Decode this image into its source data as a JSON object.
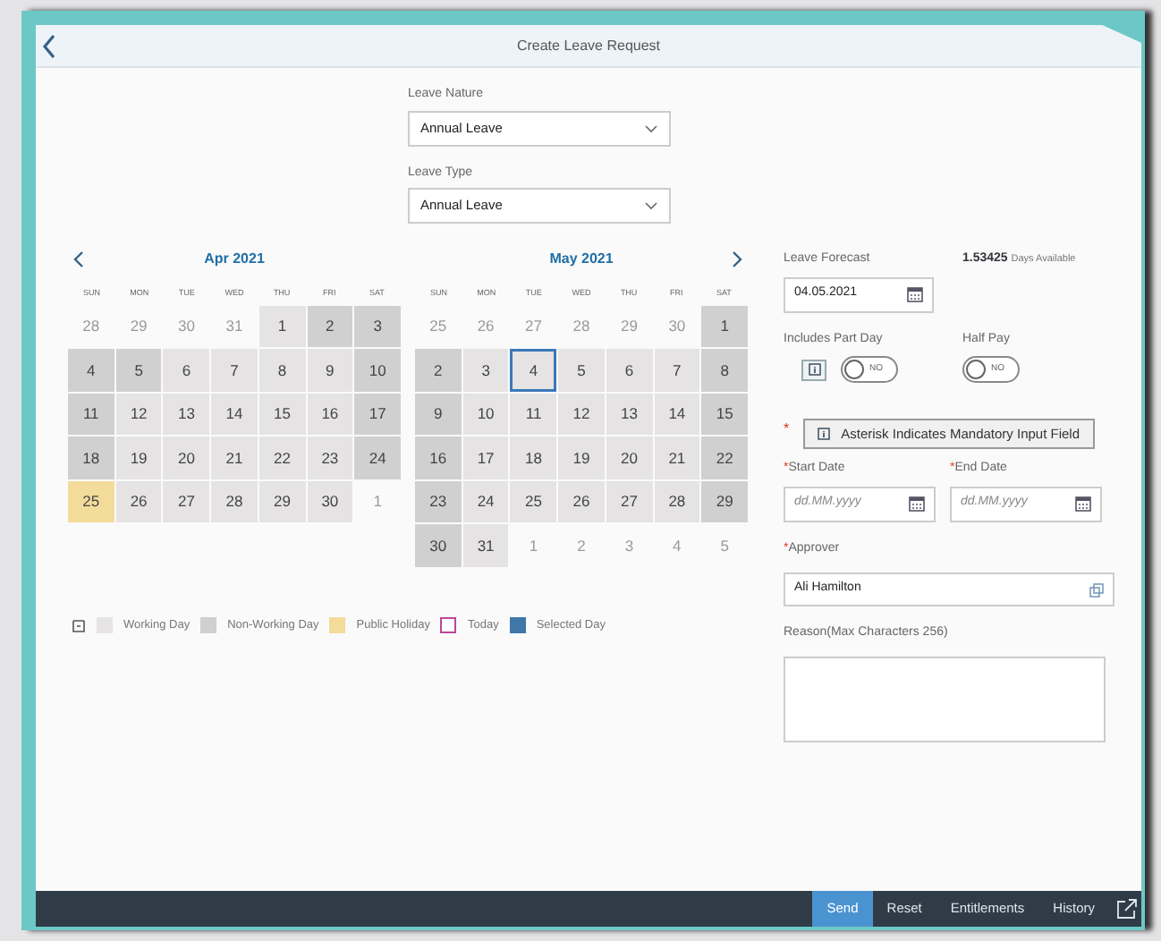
{
  "header": {
    "title": "Create Leave Request"
  },
  "selects": [
    {
      "label": "Leave Nature",
      "value": "Annual Leave"
    },
    {
      "label": "Leave Type",
      "value": "Annual Leave"
    }
  ],
  "calendars": [
    {
      "month": "Apr 2021",
      "prev_button": true,
      "next_button": false,
      "weekdays": [
        "SUN",
        "MON",
        "TUE",
        "WED",
        "THU",
        "FRI",
        "SAT"
      ],
      "weeks": [
        [
          {
            "day": "28",
            "kind": "other",
            "focused": false
          },
          {
            "day": "29",
            "kind": "other",
            "focused": false
          },
          {
            "day": "30",
            "kind": "other",
            "focused": false
          },
          {
            "day": "31",
            "kind": "other",
            "focused": false
          },
          {
            "day": "1",
            "kind": "working",
            "focused": false
          },
          {
            "day": "2",
            "kind": "nonworking",
            "focused": false
          },
          {
            "day": "3",
            "kind": "nonworking",
            "focused": false
          }
        ],
        [
          {
            "day": "4",
            "kind": "nonworking",
            "focused": false
          },
          {
            "day": "5",
            "kind": "nonworking",
            "focused": false
          },
          {
            "day": "6",
            "kind": "working",
            "focused": false
          },
          {
            "day": "7",
            "kind": "working",
            "focused": false
          },
          {
            "day": "8",
            "kind": "working",
            "focused": false
          },
          {
            "day": "9",
            "kind": "working",
            "focused": false
          },
          {
            "day": "10",
            "kind": "nonworking",
            "focused": false
          }
        ],
        [
          {
            "day": "11",
            "kind": "nonworking",
            "focused": false
          },
          {
            "day": "12",
            "kind": "working",
            "focused": false
          },
          {
            "day": "13",
            "kind": "working",
            "focused": false
          },
          {
            "day": "14",
            "kind": "working",
            "focused": false
          },
          {
            "day": "15",
            "kind": "working",
            "focused": false
          },
          {
            "day": "16",
            "kind": "working",
            "focused": false
          },
          {
            "day": "17",
            "kind": "nonworking",
            "focused": false
          }
        ],
        [
          {
            "day": "18",
            "kind": "nonworking",
            "focused": false
          },
          {
            "day": "19",
            "kind": "working",
            "focused": false
          },
          {
            "day": "20",
            "kind": "working",
            "focused": false
          },
          {
            "day": "21",
            "kind": "working",
            "focused": false
          },
          {
            "day": "22",
            "kind": "working",
            "focused": false
          },
          {
            "day": "23",
            "kind": "working",
            "focused": false
          },
          {
            "day": "24",
            "kind": "nonworking",
            "focused": false
          }
        ],
        [
          {
            "day": "25",
            "kind": "holiday",
            "focused": false
          },
          {
            "day": "26",
            "kind": "working",
            "focused": false
          },
          {
            "day": "27",
            "kind": "working",
            "focused": false
          },
          {
            "day": "28",
            "kind": "working",
            "focused": false
          },
          {
            "day": "29",
            "kind": "working",
            "focused": false
          },
          {
            "day": "30",
            "kind": "working",
            "focused": false
          },
          {
            "day": "1",
            "kind": "other",
            "focused": false
          }
        ]
      ]
    },
    {
      "month": "May 2021",
      "prev_button": false,
      "next_button": true,
      "weekdays": [
        "SUN",
        "MON",
        "TUE",
        "WED",
        "THU",
        "FRI",
        "SAT"
      ],
      "weeks": [
        [
          {
            "day": "25",
            "kind": "other",
            "focused": false
          },
          {
            "day": "26",
            "kind": "other",
            "focused": false
          },
          {
            "day": "27",
            "kind": "other",
            "focused": false
          },
          {
            "day": "28",
            "kind": "other",
            "focused": false
          },
          {
            "day": "29",
            "kind": "other",
            "focused": false
          },
          {
            "day": "30",
            "kind": "other",
            "focused": false
          },
          {
            "day": "1",
            "kind": "nonworking",
            "focused": false
          }
        ],
        [
          {
            "day": "2",
            "kind": "nonworking",
            "focused": false
          },
          {
            "day": "3",
            "kind": "working",
            "focused": false
          },
          {
            "day": "4",
            "kind": "working",
            "focused": true
          },
          {
            "day": "5",
            "kind": "working",
            "focused": false
          },
          {
            "day": "6",
            "kind": "working",
            "focused": false
          },
          {
            "day": "7",
            "kind": "working",
            "focused": false
          },
          {
            "day": "8",
            "kind": "nonworking",
            "focused": false
          }
        ],
        [
          {
            "day": "9",
            "kind": "nonworking",
            "focused": false
          },
          {
            "day": "10",
            "kind": "working",
            "focused": false
          },
          {
            "day": "11",
            "kind": "working",
            "focused": false
          },
          {
            "day": "12",
            "kind": "working",
            "focused": false
          },
          {
            "day": "13",
            "kind": "working",
            "focused": false
          },
          {
            "day": "14",
            "kind": "working",
            "focused": false
          },
          {
            "day": "15",
            "kind": "nonworking",
            "focused": false
          }
        ],
        [
          {
            "day": "16",
            "kind": "nonworking",
            "focused": false
          },
          {
            "day": "17",
            "kind": "working",
            "focused": false
          },
          {
            "day": "18",
            "kind": "working",
            "focused": false
          },
          {
            "day": "19",
            "kind": "working",
            "focused": false
          },
          {
            "day": "20",
            "kind": "working",
            "focused": false
          },
          {
            "day": "21",
            "kind": "working",
            "focused": false
          },
          {
            "day": "22",
            "kind": "nonworking",
            "focused": false
          }
        ],
        [
          {
            "day": "23",
            "kind": "nonworking",
            "focused": false
          },
          {
            "day": "24",
            "kind": "working",
            "focused": false
          },
          {
            "day": "25",
            "kind": "working",
            "focused": false
          },
          {
            "day": "26",
            "kind": "working",
            "focused": false
          },
          {
            "day": "27",
            "kind": "working",
            "focused": false
          },
          {
            "day": "28",
            "kind": "working",
            "focused": false
          },
          {
            "day": "29",
            "kind": "nonworking",
            "focused": false
          }
        ],
        [
          {
            "day": "30",
            "kind": "nonworking",
            "focused": false
          },
          {
            "day": "31",
            "kind": "working",
            "focused": false
          },
          {
            "day": "1",
            "kind": "other",
            "focused": false
          },
          {
            "day": "2",
            "kind": "other",
            "focused": false
          },
          {
            "day": "3",
            "kind": "other",
            "focused": false
          },
          {
            "day": "4",
            "kind": "other",
            "focused": false
          },
          {
            "day": "5",
            "kind": "other",
            "focused": false
          }
        ]
      ]
    }
  ],
  "legend": [
    {
      "label": "Working Day",
      "kind": "fill",
      "color": "#e5e3e3"
    },
    {
      "label": "Non-Working Day",
      "kind": "fill",
      "color": "#d0d0d0"
    },
    {
      "label": "Public Holiday",
      "kind": "fill",
      "color": "#f3db9a"
    },
    {
      "label": "Today",
      "kind": "outline",
      "color": "#b8489c"
    },
    {
      "label": "Selected Day",
      "kind": "fill",
      "color": "#3f77a8"
    }
  ],
  "forecast": {
    "label": "Leave Forecast",
    "value": "04.05.2021",
    "available": "1.53425",
    "available_unit": "Days Available"
  },
  "switches": [
    {
      "label": "Includes Part Day",
      "text": "NO",
      "on": false,
      "info": true
    },
    {
      "label": "Half Pay",
      "text": "NO",
      "on": false,
      "info": false
    }
  ],
  "mandatory_note": {
    "asterisk": "*",
    "text": "Asterisk Indicates Mandatory Input Field"
  },
  "dates": [
    {
      "label": "Start Date",
      "required": true,
      "placeholder": "dd.MM.yyyy"
    },
    {
      "label": "End Date",
      "required": true,
      "placeholder": "dd.MM.yyyy"
    }
  ],
  "approver": {
    "label": "Approver",
    "required": true,
    "value": "Ali Hamilton"
  },
  "reason": {
    "label": "Reason(Max Characters 256)"
  },
  "footer": [
    {
      "label": "Send",
      "primary": true
    },
    {
      "label": "Reset",
      "primary": false
    },
    {
      "label": "Entitlements",
      "primary": false
    },
    {
      "label": "History",
      "primary": false
    }
  ]
}
